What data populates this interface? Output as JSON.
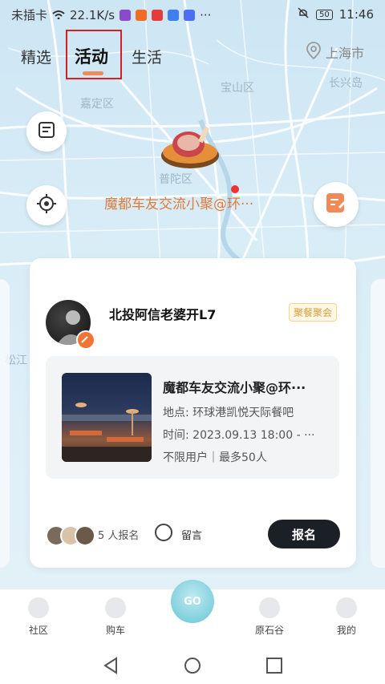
{
  "status_bar": {
    "carrier": "未插卡",
    "speed": "22.1K/s",
    "more": "···",
    "battery": "50",
    "time": "11:46"
  },
  "tabs": [
    {
      "label": "精选"
    },
    {
      "label": "活动"
    },
    {
      "label": "生活"
    }
  ],
  "city": "上海市",
  "map_labels": {
    "jiading": "嘉定区",
    "baoshan": "宝山区",
    "changxing": "长兴岛",
    "putuo": "普陀区",
    "song": "松江"
  },
  "map_marker": {
    "title": "魔都车友交流小聚@环···"
  },
  "card": {
    "username": "北投阿信老婆开L7",
    "tag": "聚餐聚会",
    "event_title": "魔都车友交流小聚@环···",
    "location": "地点: 环球港凯悦天际餐吧",
    "time": "时间: 2023.09.13 18:00 - ···",
    "limits": "不限用户｜最多50人",
    "signup_count": "5",
    "signup_suffix": "人报名",
    "message": "留言",
    "signup_button": "报名"
  },
  "bottom_nav": [
    {
      "label": "社区"
    },
    {
      "label": "购车"
    },
    {
      "label": "GO"
    },
    {
      "label": "原石谷"
    },
    {
      "label": "我的"
    }
  ],
  "colors": {
    "accent": "#f08a56",
    "tag": "#d6a13a",
    "button": "#1b2027"
  }
}
